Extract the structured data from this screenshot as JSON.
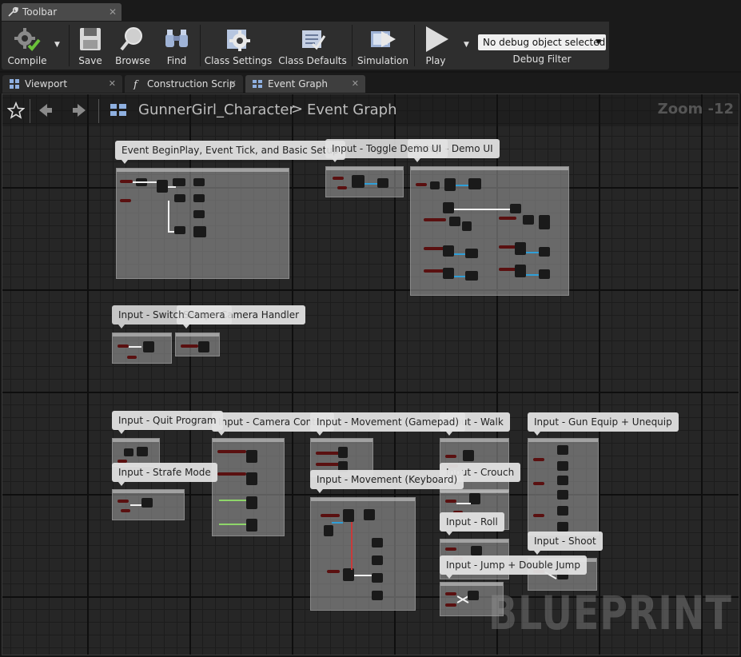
{
  "window": {
    "tab_label": "Toolbar",
    "tab_close": "✕"
  },
  "toolbar": {
    "compile": "Compile",
    "save": "Save",
    "browse": "Browse",
    "find": "Find",
    "class_settings": "Class Settings",
    "class_defaults": "Class Defaults",
    "simulation": "Simulation",
    "play": "Play",
    "debug_selected": "No debug object selected",
    "debug_filter": "Debug Filter"
  },
  "doc_tabs": [
    {
      "label": "Viewport",
      "close": "✕"
    },
    {
      "label": "Construction Scrip",
      "close": "✕"
    },
    {
      "label": "Event Graph",
      "close": "✕"
    }
  ],
  "graph": {
    "breadcrumb_root": "GunnerGirl_Character",
    "breadcrumb_sep": ">",
    "breadcrumb_leaf": "Event Graph",
    "zoom": "Zoom -12",
    "watermark": "BLUEPRINT"
  },
  "comments": [
    "Event BeginPlay, Event Tick, and Basic Setup",
    "Input - Toggle Demo UI",
    "Setup - Demo UI",
    "Input - Switch Camera",
    "Setup - Camera Handler",
    "Input - Quit Program",
    "Input - Camera Control",
    "Input - Movement (Gamepad)",
    "Input - Walk",
    "Input - Gun Equip + Unequip",
    "Input - Strafe Mode",
    "Input - Movement (Keyboard)",
    "Input - Crouch",
    "Input - Roll",
    "Input - Shoot",
    "Input - Jump + Double Jump"
  ]
}
